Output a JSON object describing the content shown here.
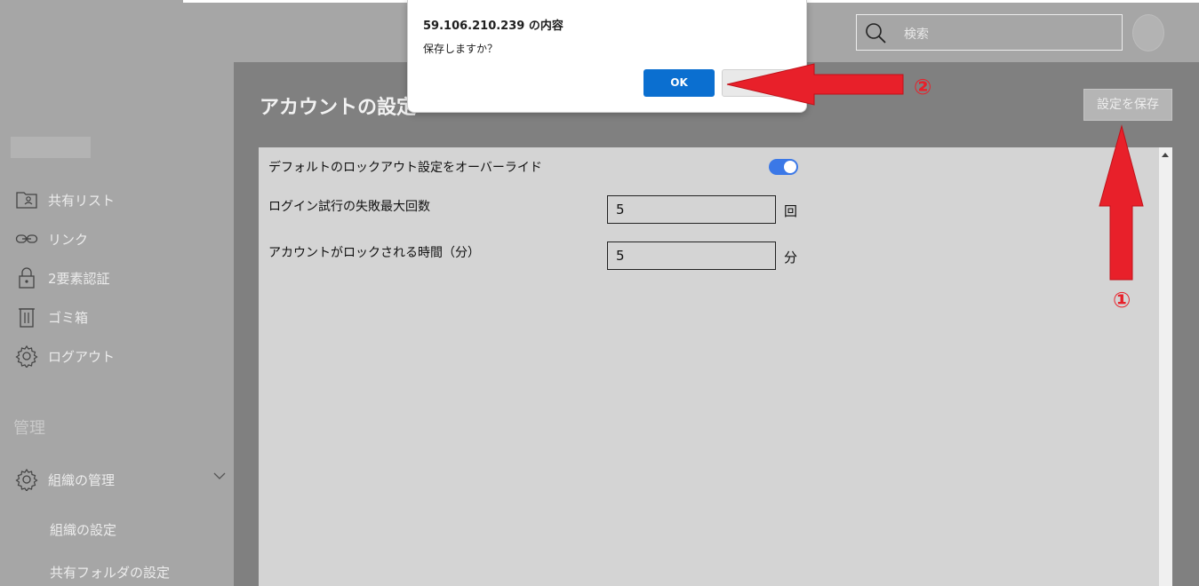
{
  "header": {
    "search_placeholder": "検索"
  },
  "sidebar": {
    "items": [
      {
        "label": "共有リスト",
        "icon": "contact-card-icon"
      },
      {
        "label": "リンク",
        "icon": "link-icon"
      },
      {
        "label": "2要素認証",
        "icon": "lock-icon"
      },
      {
        "label": "ゴミ箱",
        "icon": "trash-icon"
      },
      {
        "label": "ログアウト",
        "icon": "gear-icon"
      }
    ],
    "admin_section_title": "管理",
    "org_manage": {
      "label": "組織の管理",
      "icon": "gear-icon"
    },
    "sub_items": [
      "組織の設定",
      "共有フォルダの設定"
    ]
  },
  "main": {
    "title": "アカウントの設定",
    "save_button": "設定を保存",
    "settings": {
      "override_label": "デフォルトのロックアウト設定をオーバーライド",
      "override_enabled": true,
      "max_fail_label": "ログイン試行の失敗最大回数",
      "max_fail_value": "5",
      "max_fail_unit": "回",
      "lock_time_label": "アカウントがロックされる時間（分）",
      "lock_time_value": "5",
      "lock_time_unit": "分"
    }
  },
  "dialog": {
    "title": "59.106.210.239 の内容",
    "message": "保存しますか？",
    "ok_label": "OK",
    "cancel_label": ""
  },
  "annotations": {
    "marker_1": "①",
    "marker_2": "②",
    "arrow_color": "#e8202a"
  },
  "colors": {
    "toggle_on": "#3b78e7",
    "ok_button": "#0b6fd0"
  }
}
